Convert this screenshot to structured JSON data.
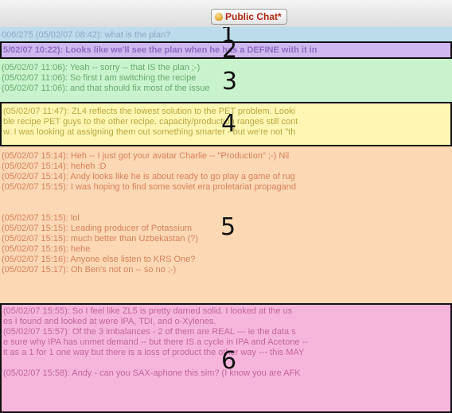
{
  "window": {
    "tab_label": "Public Chat*",
    "tab_icon": "chat-bubble-icon"
  },
  "colors": {
    "section_1": "#bcdcec",
    "section_2": "#cfb8ef",
    "section_3": "#c8f3cc",
    "section_4": "#fff6b4",
    "section_5": "#fcd8b4",
    "section_6": "#f6b6dc"
  },
  "sections": [
    {
      "number": "1",
      "lines": [
        "006/275 (05/02/07 08:42): what is the plan?"
      ],
      "text_color": "#8fa6c4"
    },
    {
      "number": "2",
      "lines": [
        "5/02/07 10:22): Looks like we'll see the plan when he has a DEFINE with it in"
      ],
      "text_color": "#8f6cc4"
    },
    {
      "number": "3",
      "lines": [
        "(05/02/07 11:06): Yeah -- sorry -- that IS the plan ;-)",
        "(05/02/07 11:06): So first I am switching the recipe",
        "(05/02/07 11:06): and that should fix most of the issue"
      ],
      "text_color": "#6aaa70"
    },
    {
      "number": "4",
      "lines": [
        "(05/02/07 11:47): ZL4 reflects the lowest solution to the PET problem. Looki",
        "ble recipe PET guys to the other recipe. capacity/production ranges still cont",
        "w. I was looking at assigning them out something smarter - but we're not \"th"
      ],
      "text_color": "#b8a840"
    },
    {
      "number": "5",
      "lines": [
        "(05/02/07 15:14): Heh -- I just got your avatar Charlie -- \"Production\" ;-) Nil",
        "(05/02/07 15:14): heheh :D",
        "(05/02/07 15:14): Andy looks like he is about ready to go play a game of rug",
        "(05/02/07 15:15): I was hoping to find some soviet era proletariat propagand",
        "",
        "(05/02/07 15:15): lol",
        "(05/02/07 15:15): Leading producer of Potassium",
        "(05/02/07 15:15): much better than Uzbekastan (?)",
        "(05/02/07 15:16): hehe",
        "(05/02/07 15:16): Anyone else listen to KRS One?",
        "(05/02/07 15:17): Oh Ben's not on -- so no ;-)"
      ],
      "text_color": "#d4825c"
    },
    {
      "number": "6",
      "lines": [
        "(05/02/07 15:55): So I feel like ZL5 is pretty darned solid. I looked at the us",
        "es I found and looked at were IPA, TDI, and o-Xylenes.",
        "(05/02/07 15:57): Of the 3 imbalances - 2 of them are REAL --- ie the data s",
        "e sure why IPA has unmet demand -- but there IS a cycle in IPA and Acetone --",
        "it as a 1 for 1 one way but there is a loss of product the other way --- this MAY",
        "",
        "(05/02/07 15:58): Andy - can you SAX-aphone this sim? (I know you are AFK"
      ],
      "text_color": "#c2669c"
    }
  ]
}
